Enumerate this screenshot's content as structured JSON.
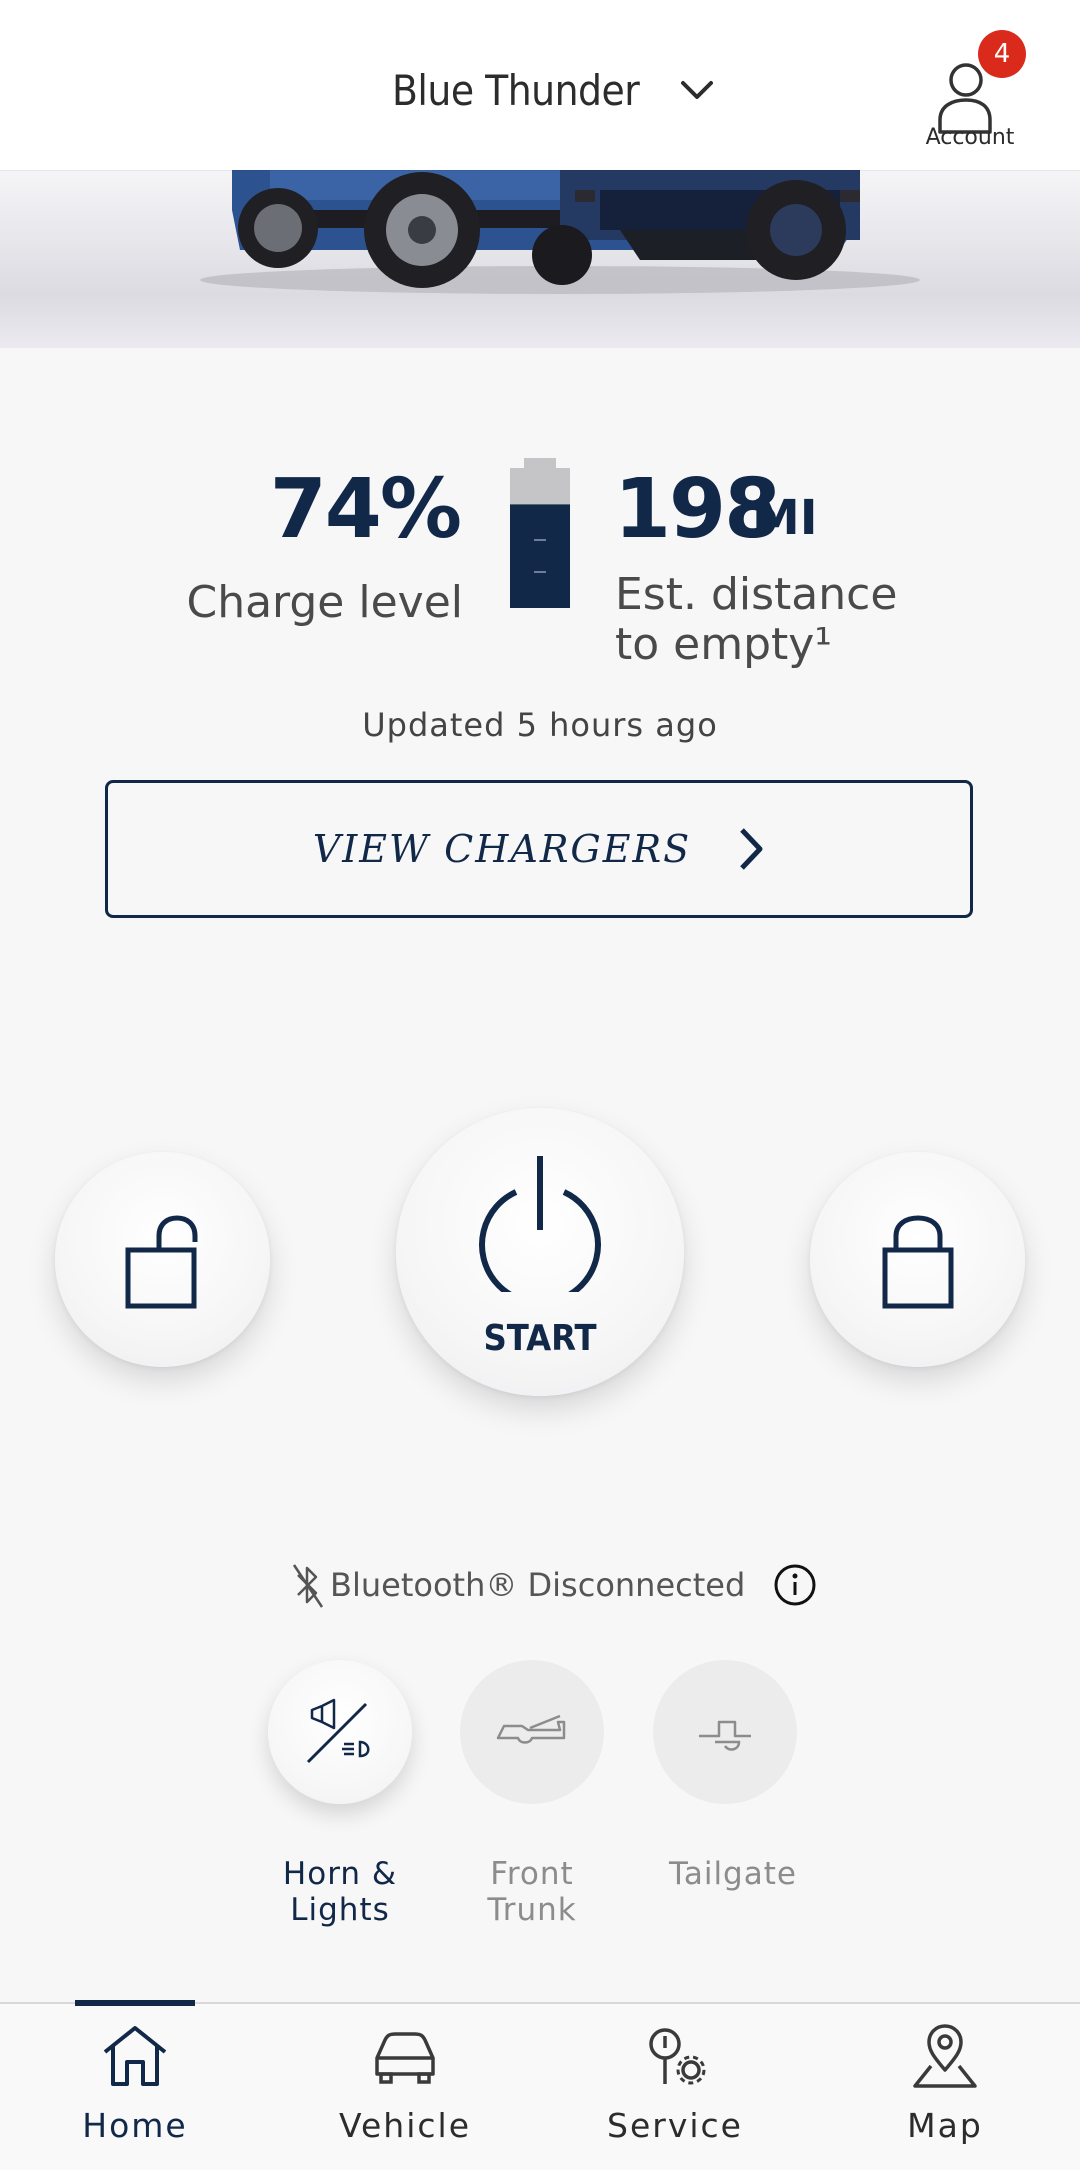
{
  "header": {
    "vehicle_name": "Blue Thunder",
    "account_label": "Account",
    "notification_count": "4"
  },
  "charge": {
    "percent": "74%",
    "label": "Charge level",
    "level_fraction": 0.74
  },
  "range": {
    "value": "198",
    "unit": "MI",
    "label": "Est. distance to empty¹"
  },
  "updated": "Updated 5 hours ago",
  "view_chargers": "VIEW CHARGERS",
  "remote": {
    "start_label": "START"
  },
  "bluetooth": {
    "status": "Bluetooth® Disconnected"
  },
  "quick_actions": [
    {
      "label": "Horn & Lights",
      "enabled": true
    },
    {
      "label": "Front Trunk",
      "enabled": false
    },
    {
      "label": "Tailgate",
      "enabled": false
    }
  ],
  "nav": {
    "home": "Home",
    "vehicle": "Vehicle",
    "service": "Service",
    "map": "Map"
  },
  "colors": {
    "primary": "#112848",
    "badge": "#d92a1c",
    "disabled_text": "#8c8c8c"
  }
}
